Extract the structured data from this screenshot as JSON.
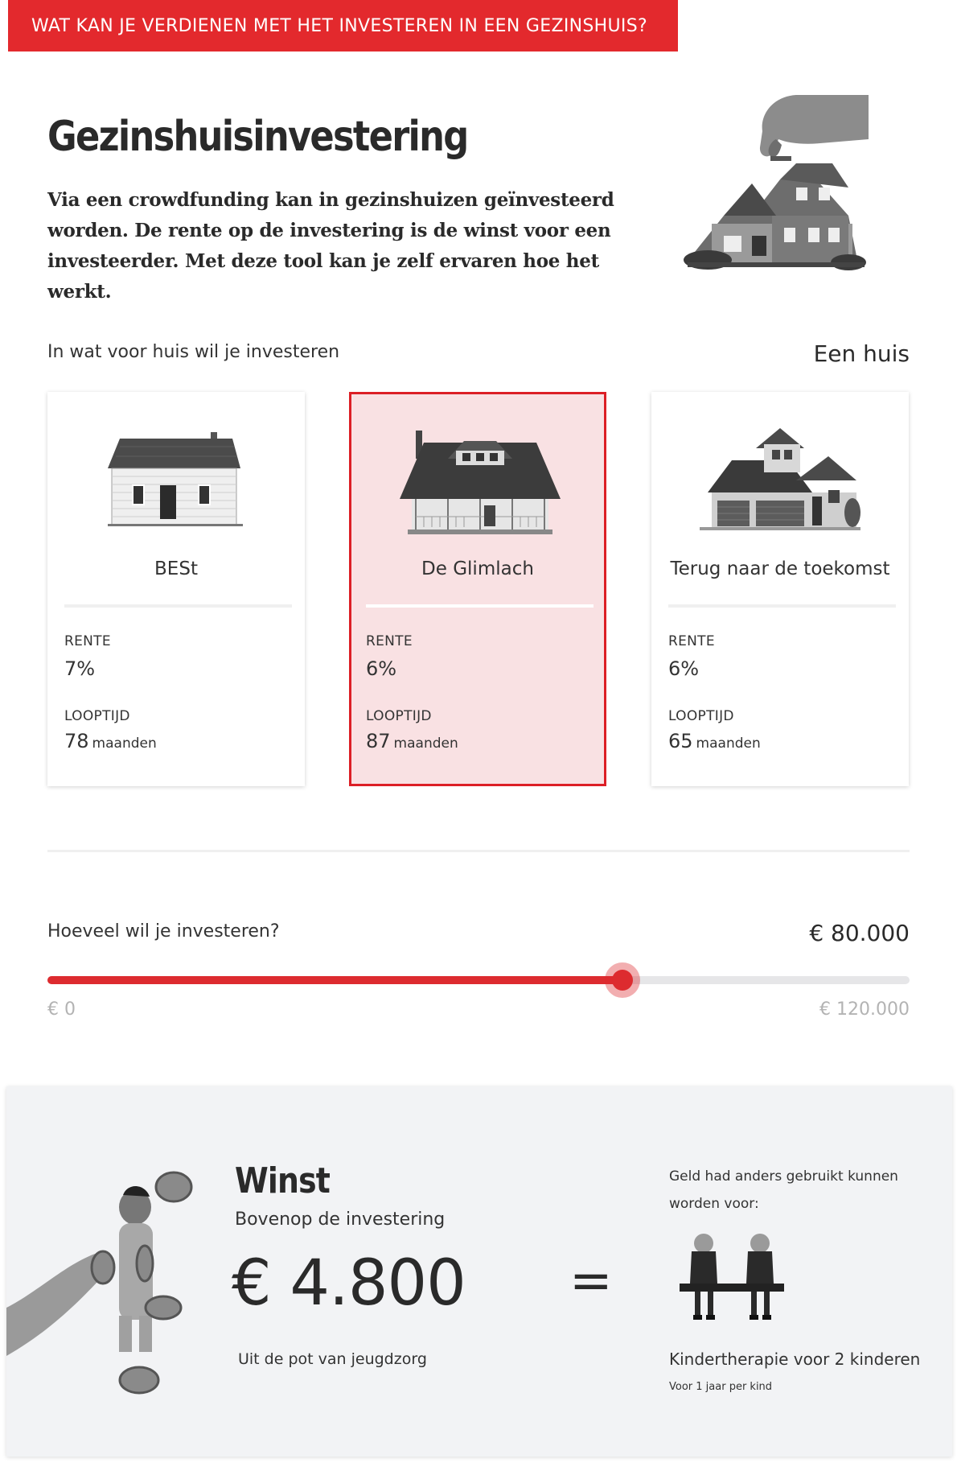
{
  "banner": {
    "text": "WAT KAN JE VERDIENEN MET HET INVESTEREN IN EEN GEZINSHUIS?"
  },
  "hero": {
    "title": "Gezinshuisinvestering",
    "text": "Via een crowdfunding kan in gezinshuizen geïnvesteerd worden. De rente op de investering is de winst voor een investeerder. Met deze tool kan je zelf ervaren hoe het werkt."
  },
  "house_select": {
    "question": "In wat voor huis wil je investeren",
    "selected_label": "Een huis",
    "cards": [
      {
        "name": "BESt",
        "rente_label": "RENTE",
        "rente": "7%",
        "looptijd_label": "LOOPTIJD",
        "looptijd": "78",
        "unit": "maanden",
        "selected": false
      },
      {
        "name": "De Glimlach",
        "rente_label": "RENTE",
        "rente": "6%",
        "looptijd_label": "LOOPTIJD",
        "looptijd": "87",
        "unit": "maanden",
        "selected": true
      },
      {
        "name": "Terug naar de toekomst",
        "rente_label": "RENTE",
        "rente": "6%",
        "looptijd_label": "LOOPTIJD",
        "looptijd": "65",
        "unit": "maanden",
        "selected": false
      }
    ]
  },
  "invest": {
    "question": "Hoeveel wil je investeren?",
    "value_label": "€ 80.000",
    "min_label": "€ 0",
    "max_label": "€ 120.000",
    "value": 80000,
    "min": 0,
    "max": 120000
  },
  "result": {
    "title": "Winst",
    "subtitle": "Bovenop de investering",
    "amount": "€ 4.800",
    "source": "Uit de pot van jeugdzorg",
    "equals": "=",
    "alt_intro": "Geld had anders gebruikt kunnen worden voor:",
    "alt_title": "Kindertherapie voor 2 kinderen",
    "alt_note": "Voor 1 jaar per kind"
  },
  "colors": {
    "accent": "#e3292d",
    "selected_bg": "#f9e1e3",
    "selected_border": "#dc1f26",
    "result_bg": "#f2f3f5"
  },
  "icons": [
    "hand-house-image",
    "cottage-house-image",
    "porch-house-image",
    "modern-house-image",
    "child-coins-image",
    "children-bench-image"
  ]
}
